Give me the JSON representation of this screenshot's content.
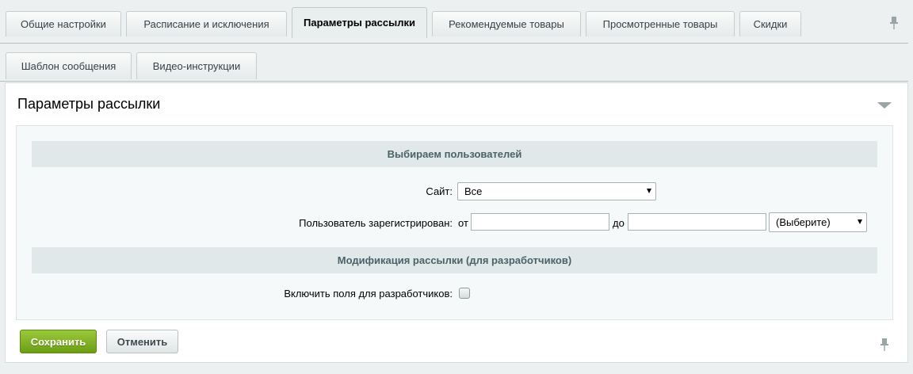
{
  "tabs_row1": [
    {
      "label": "Общие настройки",
      "active": false
    },
    {
      "label": "Расписание и исключения",
      "active": false
    },
    {
      "label": "Параметры рассылки",
      "active": true
    },
    {
      "label": "Рекомендуемые товары",
      "active": false
    },
    {
      "label": "Просмотренные товары",
      "active": false
    },
    {
      "label": "Скидки",
      "active": false
    }
  ],
  "tabs_row2": [
    {
      "label": "Шаблон сообщения"
    },
    {
      "label": "Видео-инструкции"
    }
  ],
  "panel": {
    "title": "Параметры рассылки",
    "section_users": "Выбираем пользователей",
    "site_label": "Сайт:",
    "site_value": "Все",
    "registered_label": "Пользователь зарегистрирован:",
    "from_label": "от",
    "to_label": "до",
    "from_value": "",
    "to_value": "",
    "period_select": "(Выберите)",
    "section_dev": "Модификация рассылки (для разработчиков)",
    "dev_fields_label": "Включить поля для разработчиков:",
    "dev_fields_checked": false
  },
  "buttons": {
    "save": "Сохранить",
    "cancel": "Отменить"
  },
  "colors": {
    "save_button": "#7fb21f",
    "section_header": "#e0e8ea",
    "page_bg": "#ecf0f1"
  }
}
